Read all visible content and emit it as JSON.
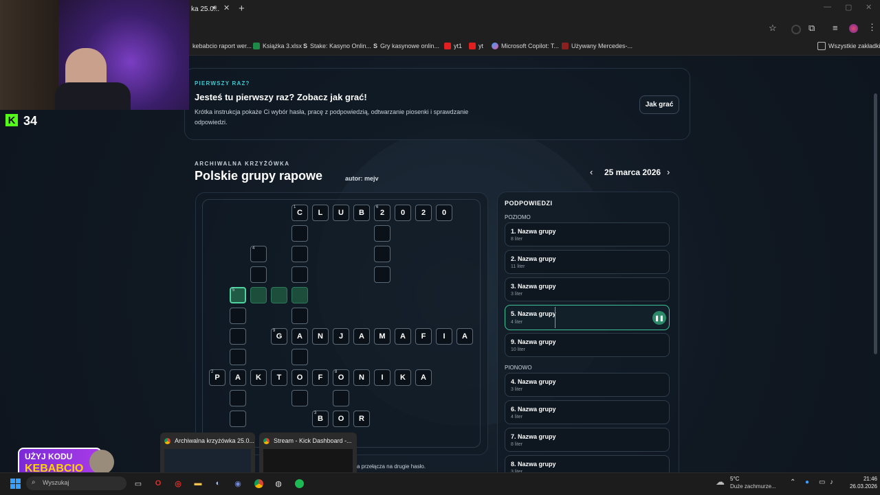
{
  "browser": {
    "tab_title": "ka 25.0...",
    "bookmarks": [
      {
        "label": "kebabcio raport wer...",
        "icon": "folder-icon"
      },
      {
        "label": "Książka 3.xlsx",
        "icon": "excel-icon"
      },
      {
        "label": "Stake: Kasyno Onlin...",
        "icon": "stake-icon"
      },
      {
        "label": "Gry kasynowe onlin...",
        "icon": "stake-icon"
      },
      {
        "label": "yt1",
        "icon": "youtube-icon"
      },
      {
        "label": "yt",
        "icon": "youtube-icon"
      },
      {
        "label": "Microsoft Copilot: T...",
        "icon": "copilot-icon"
      },
      {
        "label": "Używany Mercedes-...",
        "icon": "car-icon"
      }
    ],
    "all_bookmarks": "Wszystkie zakładki"
  },
  "overlay": {
    "kick_count": "34",
    "promo_line1": "UŻYJ KODU",
    "promo_line2": "KEBABCIO"
  },
  "banner": {
    "eyebrow": "PIERWSZY RAZ?",
    "title": "Jesteś tu pierwszy raz? Zobacz jak grać!",
    "description": "Krótka instrukcja pokaże Ci wybór hasła, pracę z podpowiedzią, odtwarzanie piosenki i sprawdzanie odpowiedzi.",
    "button": "Jak grać"
  },
  "puzzle": {
    "eyebrow": "ARCHIWALNA KRZYŻÓWKA",
    "title": "Polskie grupy rapowe",
    "author": "autor: mejv",
    "date": "25 marca 2026"
  },
  "hints": {
    "title": "PODPOWIEDZI",
    "horizontal_label": "POZIOMO",
    "vertical_label": "PIONOWO",
    "horizontal": [
      {
        "label": "1. Nazwa grupy",
        "sub": "8 liter"
      },
      {
        "label": "2. Nazwa grupy",
        "sub": "11 liter"
      },
      {
        "label": "3. Nazwa grupy",
        "sub": "3 liter"
      },
      {
        "label": "5. Nazwa grupy",
        "sub": "4 liter"
      },
      {
        "label": "9. Nazwa grupy",
        "sub": "10 liter"
      }
    ],
    "vertical": [
      {
        "label": "4. Nazwa grupy",
        "sub": "3 liter"
      },
      {
        "label": "6. Nazwa grupy",
        "sub": "4 liter"
      },
      {
        "label": "7. Nazwa grupy",
        "sub": "8 liter"
      },
      {
        "label": "8. Nazwa grupy",
        "sub": "3 liter"
      }
    ]
  },
  "footer_hint": "a przełącza na drugie hasło.",
  "grid": {
    "row_letters": {
      "row0": [
        "C",
        "L",
        "U",
        "B",
        "2",
        "0",
        "2",
        "0"
      ],
      "row6": [
        "G",
        "A",
        "N",
        "J",
        "A",
        "M",
        "A",
        "F",
        "I",
        "A"
      ],
      "row8": [
        "P",
        "A",
        "K",
        "T",
        "O",
        "F",
        "O",
        "N",
        "I",
        "K",
        "A"
      ],
      "row10": [
        "B",
        "O",
        "R"
      ]
    }
  },
  "task_previews": [
    {
      "label": "Archiwalna krzyżówka 25.0..."
    },
    {
      "label": "Stream - Kick Dashboard -..."
    }
  ],
  "taskbar": {
    "search_placeholder": "Wyszukaj",
    "weather_temp": "5°C",
    "weather_desc": "Duże zachmurze...",
    "time": "21:46",
    "date": "26.03.2026"
  }
}
